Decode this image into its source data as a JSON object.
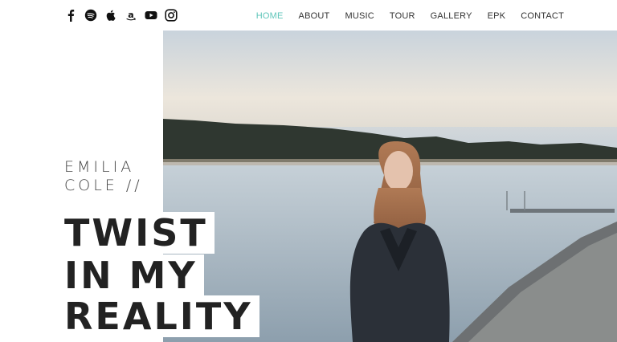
{
  "social": [
    {
      "name": "facebook-icon"
    },
    {
      "name": "spotify-icon"
    },
    {
      "name": "apple-icon"
    },
    {
      "name": "amazon-icon"
    },
    {
      "name": "youtube-icon"
    },
    {
      "name": "instagram-icon"
    }
  ],
  "nav": {
    "items": [
      "HOME",
      "ABOUT",
      "MUSIC",
      "TOUR",
      "GALLERY",
      "EPK",
      "CONTACT"
    ],
    "active": "HOME",
    "active_color": "#5ec5b9"
  },
  "artist": {
    "first": "EMILIA",
    "last": "COLE //"
  },
  "title": {
    "line1": "TWIST",
    "line2": "IN MY",
    "line3": "REALITY"
  }
}
